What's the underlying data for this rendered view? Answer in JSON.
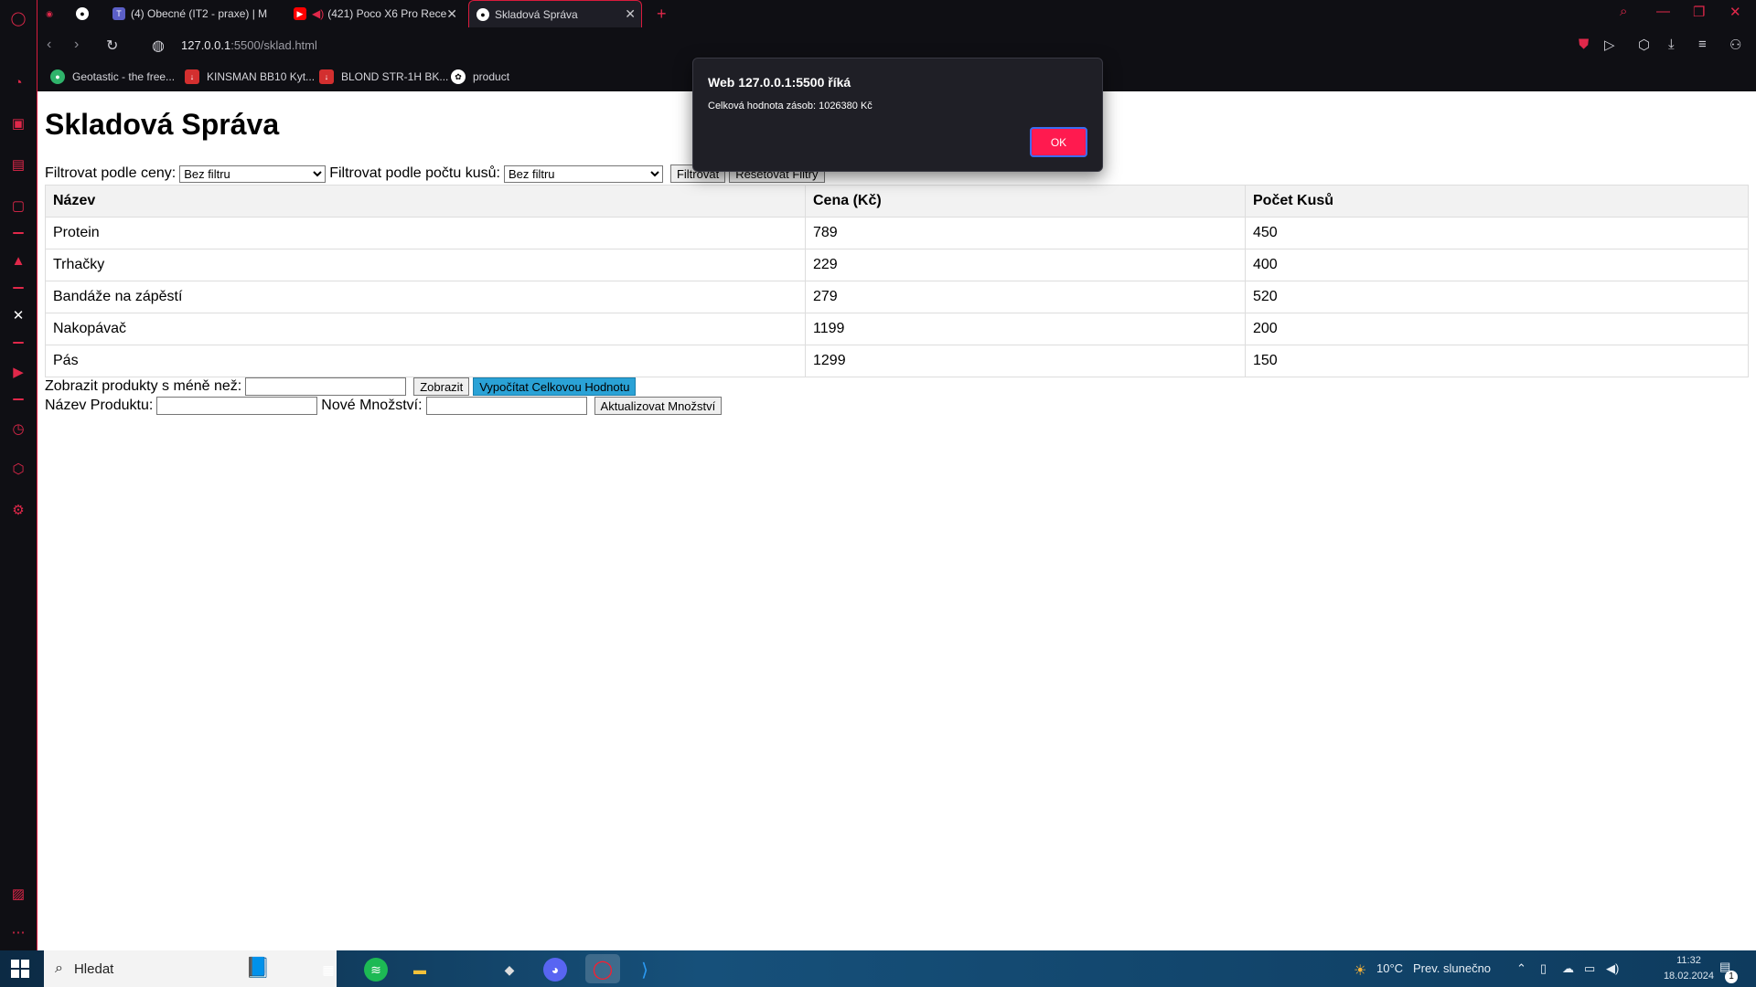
{
  "browser": {
    "tabs": [
      {
        "label": "(4) Obecné (IT2 - praxe) | M",
        "icon": "teams-icon"
      },
      {
        "label": "(421) Poco X6 Pro Rece",
        "icon": "youtube-icon"
      },
      {
        "label": "Skladová Správa",
        "icon": "globe-icon"
      }
    ],
    "address": {
      "host": "127.0.0.1",
      "path": ":5500/sklad.html"
    },
    "bookmarks": [
      {
        "label": "Geotastic - the free...",
        "icon": "geotastic-icon",
        "color": "#2fb36b"
      },
      {
        "label": "KINSMAN BB10 Kyt...",
        "icon": "kinsman-icon",
        "color": "#d32f2f"
      },
      {
        "label": "BLOND STR-1H BK...",
        "icon": "blond-icon",
        "color": "#d32f2f"
      },
      {
        "label": "product",
        "icon": "product-icon",
        "color": "#444444"
      }
    ]
  },
  "page": {
    "title": "Skladová Správa",
    "filters": {
      "price_label": "Filtrovat podle ceny:",
      "price_selected": "Bez filtru",
      "qty_label": "Filtrovat podle počtu kusů:",
      "qty_selected": "Bez filtru",
      "filter_button": "Filtrovat",
      "reset_button": "Resetovat Filtry"
    },
    "table": {
      "headers": [
        "Název",
        "Cena (Kč)",
        "Počet Kusů"
      ],
      "rows": [
        [
          "Protein",
          "789",
          "450"
        ],
        [
          "Trhačky",
          "229",
          "400"
        ],
        [
          "Bandáže na zápěstí",
          "279",
          "520"
        ],
        [
          "Nakopávač",
          "1199",
          "200"
        ],
        [
          "Pás",
          "1299",
          "150"
        ]
      ]
    },
    "low_stock": {
      "label": "Zobrazit produkty s méně než:",
      "value": "",
      "show_button": "Zobrazit",
      "calc_button": "Vypočítat Celkovou Hodnotu"
    },
    "update": {
      "name_label": "Název Produktu:",
      "name_value": "",
      "qty_label": "Nové Množství:",
      "qty_value": "",
      "button": "Aktualizovat Množství"
    }
  },
  "dialog": {
    "title": "Web 127.0.0.1:5500 říká",
    "message": "Celková hodnota zásob: 1026380 Kč",
    "ok": "OK"
  },
  "taskbar": {
    "search": "Hledat",
    "weather": "10°C",
    "weather_text": "Prev. slunečno",
    "time": "11:32",
    "date": "18.02.2024",
    "notification_count": "1"
  },
  "colors": {
    "accent": "#e0284a",
    "dialog_ok": "#ff1a4f",
    "calc_button": "#2aa2d6"
  }
}
